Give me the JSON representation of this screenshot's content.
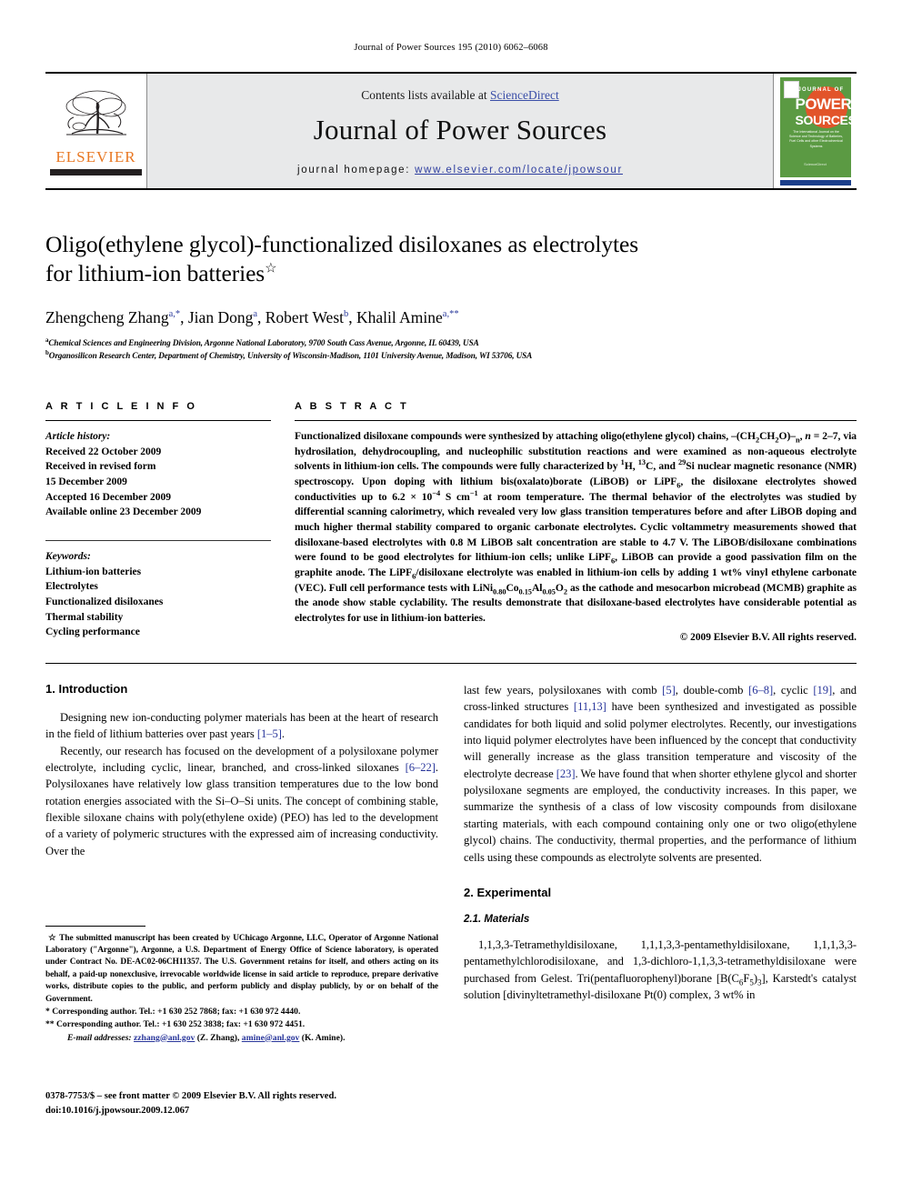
{
  "running_head": "Journal of Power Sources 195 (2010) 6062–6068",
  "masthead": {
    "contents_prefix": "Contents lists available at ",
    "sciencedirect": "ScienceDirect",
    "journal_name": "Journal of Power Sources",
    "homepage_label": "journal homepage:",
    "homepage_url": "www.elsevier.com/locate/jpowsour",
    "publisher_logo_text": "ELSEVIER",
    "cover": {
      "journal_of": "JOURNAL OF",
      "power": "POWER",
      "sources": "SOURCES",
      "subtitle": "The International Journal on the Science and Technology of Batteries, Fuel Cells and other Electrochemical Systems",
      "footer": "ScienceDirect"
    },
    "accent_link_color": "#2f3fa0",
    "elsevier_orange": "#e87722",
    "cover_green": "#5b9a43"
  },
  "article": {
    "title_line1": "Oligo(ethylene glycol)-functionalized disiloxanes as electrolytes",
    "title_line2": "for lithium-ion batteries",
    "title_footnote_mark": "☆",
    "authors": [
      {
        "name": "Zhengcheng Zhang",
        "marks": "a,*"
      },
      {
        "name": "Jian Dong",
        "marks": "a"
      },
      {
        "name": "Robert West",
        "marks": "b"
      },
      {
        "name": "Khalil Amine",
        "marks": "a,**"
      }
    ],
    "affiliations": [
      {
        "mark": "a",
        "text": "Chemical Sciences and Engineering Division, Argonne National Laboratory, 9700 South Cass Avenue, Argonne, IL 60439, USA"
      },
      {
        "mark": "b",
        "text": "Organosilicon Research Center, Department of Chemistry, University of Wisconsin-Madison, 1101 University Avenue, Madison, WI 53706, USA"
      }
    ]
  },
  "article_info": {
    "heading": "A R T I C L E   I N F O",
    "history_label": "Article history:",
    "history": [
      "Received 22 October 2009",
      "Received in revised form",
      "15 December 2009",
      "Accepted 16 December 2009",
      "Available online 23 December 2009"
    ],
    "keywords_label": "Keywords:",
    "keywords": [
      "Lithium-ion batteries",
      "Electrolytes",
      "Functionalized disiloxanes",
      "Thermal stability",
      "Cycling performance"
    ]
  },
  "abstract": {
    "heading": "A B S T R A C T",
    "copyright": "© 2009 Elsevier B.V. All rights reserved."
  },
  "sections": {
    "introduction_heading": "1. Introduction",
    "experimental_heading": "2. Experimental",
    "materials_heading": "2.1. Materials"
  },
  "footnotes": {
    "star_mark": "☆",
    "star_text": "The submitted manuscript has been created by UChicago Argonne, LLC, Operator of Argonne National Laboratory (\"Argonne\"), Argonne, a U.S. Department of Energy Office of Science laboratory, is operated under Contract No. DE-AC02-06CH11357. The U.S. Government retains for itself, and others acting on its behalf, a paid-up nonexclusive, irrevocable worldwide license in said article to reproduce, prepare derivative works, distribute copies to the public, and perform publicly and display publicly, by or on behalf of the Government.",
    "corresponding_1": "* Corresponding author. Tel.: +1 630 252 7868; fax: +1 630 972 4440.",
    "corresponding_2": "** Corresponding author. Tel.: +1 630 252 3838; fax: +1 630 972 4451.",
    "email_label": "E-mail addresses:",
    "email_1": "zzhang@anl.gov",
    "email_1_owner": "(Z. Zhang),",
    "email_2": "amine@anl.gov",
    "email_2_owner": "(K. Amine).",
    "issn_line": "0378-7753/$ – see front matter © 2009 Elsevier B.V. All rights reserved.",
    "doi_line": "doi:10.1016/j.jpowsour.2009.12.067"
  }
}
